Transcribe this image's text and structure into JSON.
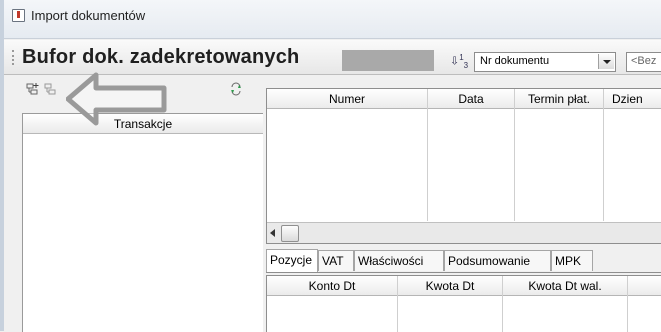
{
  "window": {
    "title": "Import dokumentów",
    "icon": "app-icon"
  },
  "header": {
    "title": "Bufor dok. zadekretowanych",
    "sort_combo": {
      "value": "Nr dokumentu"
    },
    "filter_field": {
      "value": "<Bez"
    }
  },
  "left_pane": {
    "tools": [
      "add-icon",
      "remove-icon",
      "refresh-icon"
    ],
    "column_header": "Transakcje"
  },
  "main_grid": {
    "columns": [
      "Numer",
      "Data",
      "Termin płat.",
      "Dzien"
    ]
  },
  "tabs": [
    "Pozycje",
    "VAT",
    "Właściwości",
    "Podsumowanie",
    "MPK"
  ],
  "detail_grid": {
    "columns": [
      "Konto Dt",
      "Kwota Dt",
      "Kwota Dt wal."
    ]
  },
  "colors": {
    "arrow_stroke": "#9a9a9a",
    "title_bar": "#eef1f5"
  }
}
